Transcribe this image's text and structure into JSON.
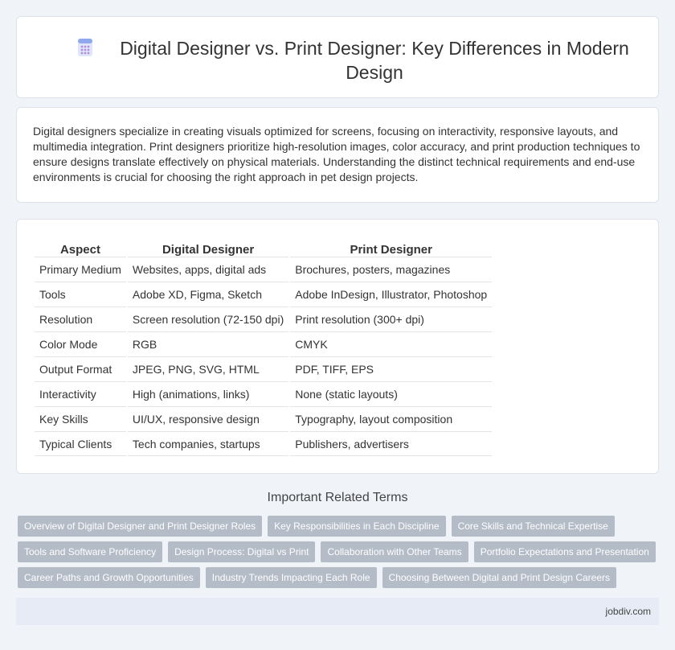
{
  "header": {
    "title": "Digital Designer vs. Print Designer: Key Differences in Modern Design",
    "icon": "calculator-icon"
  },
  "intro": {
    "text": "Digital designers specialize in creating visuals optimized for screens, focusing on interactivity, responsive layouts, and multimedia integration. Print designers prioritize high-resolution images, color accuracy, and print production techniques to ensure designs translate effectively on physical materials. Understanding the distinct technical requirements and end-use environments is crucial for choosing the right approach in pet design projects."
  },
  "comparison": {
    "headers": [
      "Aspect",
      "Digital Designer",
      "Print Designer"
    ],
    "rows": [
      [
        "Primary Medium",
        "Websites, apps, digital ads",
        "Brochures, posters, magazines"
      ],
      [
        "Tools",
        "Adobe XD, Figma, Sketch",
        "Adobe InDesign, Illustrator, Photoshop"
      ],
      [
        "Resolution",
        "Screen resolution (72-150 dpi)",
        "Print resolution (300+ dpi)"
      ],
      [
        "Color Mode",
        "RGB",
        "CMYK"
      ],
      [
        "Output Format",
        "JPEG, PNG, SVG, HTML",
        "PDF, TIFF, EPS"
      ],
      [
        "Interactivity",
        "High (animations, links)",
        "None (static layouts)"
      ],
      [
        "Key Skills",
        "UI/UX, responsive design",
        "Typography, layout composition"
      ],
      [
        "Typical Clients",
        "Tech companies, startups",
        "Publishers, advertisers"
      ]
    ]
  },
  "related": {
    "heading": "Important Related Terms",
    "rows": [
      [
        "Overview of Digital Designer and Print Designer Roles",
        "Key Responsibilities in Each Discipline",
        "Core Skills and Technical Expertise"
      ],
      [
        "Tools and Software Proficiency",
        "Design Process: Digital vs Print",
        "Collaboration with Other Teams",
        "Portfolio Expectations and Presentation"
      ],
      [
        "Career Paths and Growth Opportunities",
        "Industry Trends Impacting Each Role",
        "Choosing Between Digital and Print Design Careers"
      ]
    ]
  },
  "footer": {
    "site": "jobdiv.com"
  },
  "colors": {
    "background": "#f0f3f8",
    "tag_background": "#b4bcc8",
    "footer_background": "#e6ebf5",
    "icon_accent": "#7b9be6"
  }
}
